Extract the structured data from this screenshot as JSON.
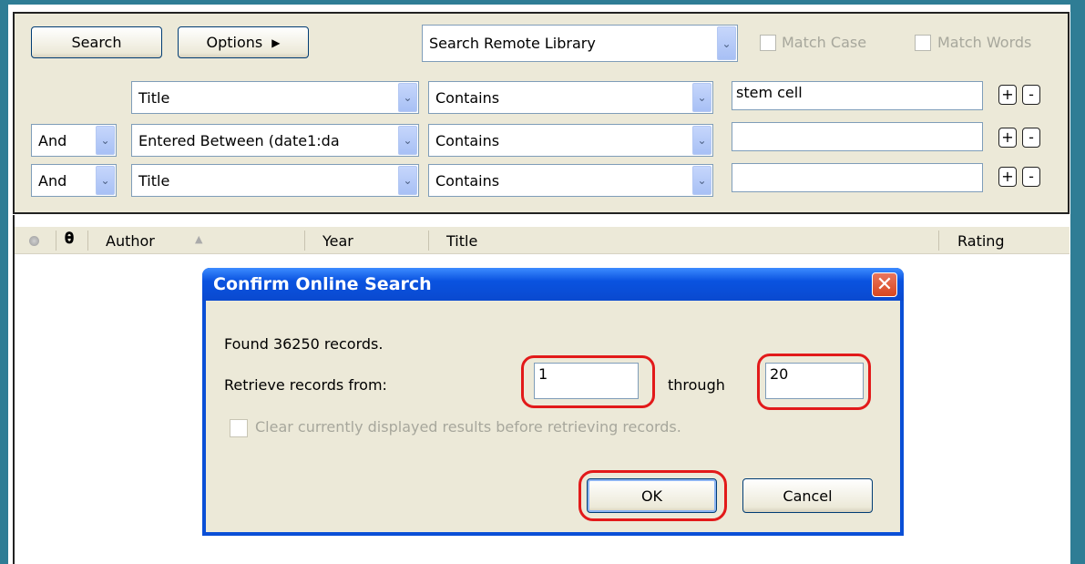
{
  "toolbar": {
    "search_label": "Search",
    "options_label": "Options",
    "options_arrow": "▶",
    "library_select": "Search Remote Library",
    "match_case_label": "Match Case",
    "match_words_label": "Match Words"
  },
  "criteria": [
    {
      "bool": "",
      "field": "Title",
      "operator": "Contains",
      "value": ""
    },
    {
      "bool": "And",
      "field": "Entered Between (date1:da",
      "operator": "Contains",
      "value": ""
    },
    {
      "bool": "And",
      "field": "Title",
      "operator": "Contains",
      "value": ""
    }
  ],
  "criteria_first_value": "stem cell",
  "plus_label": "+",
  "minus_label": "-",
  "columns": {
    "author": "Author",
    "sort_indicator": "▲",
    "year": "Year",
    "title": "Title",
    "rating": "Rating"
  },
  "dialog": {
    "title": "Confirm Online Search",
    "close_glyph": "✕",
    "found_text": "Found 36250 records.",
    "retrieve_label": "Retrieve records from:",
    "from_value": "1",
    "through_label": "through",
    "to_value": "20",
    "clear_label": "Clear currently displayed results before retrieving records.",
    "ok_label": "OK",
    "cancel_label": "Cancel"
  },
  "colors": {
    "frame": "#2f7d95",
    "highlight_ring": "#e21a1a",
    "dialog_title": "#0a53e0"
  }
}
